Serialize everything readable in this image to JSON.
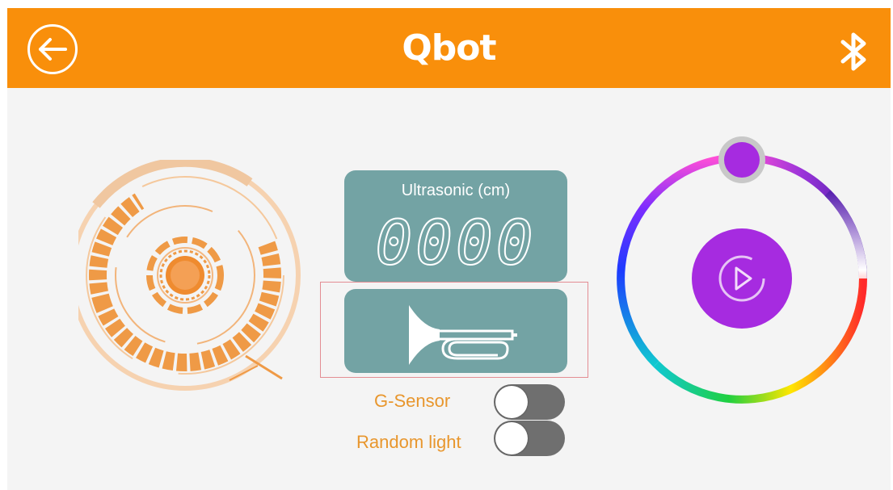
{
  "header": {
    "title": "Qbot",
    "back_icon": "arrow-left-icon",
    "bluetooth_icon": "bluetooth-icon",
    "background_color": "#f98f0b"
  },
  "ultrasonic": {
    "label": "Ultrasonic (cm)",
    "value": "0000",
    "panel_color": "#73a3a4"
  },
  "horn": {
    "icon": "horn-icon"
  },
  "toggles": [
    {
      "label": "G-Sensor",
      "on": false
    },
    {
      "label": "Random light",
      "on": false
    }
  ],
  "joystick": {
    "icon": "joystick-icon",
    "accent_color": "#ef9a46"
  },
  "color_wheel": {
    "icon": "color-wheel-icon",
    "center_icon": "play-icon",
    "selected_color": "#a62be0"
  }
}
